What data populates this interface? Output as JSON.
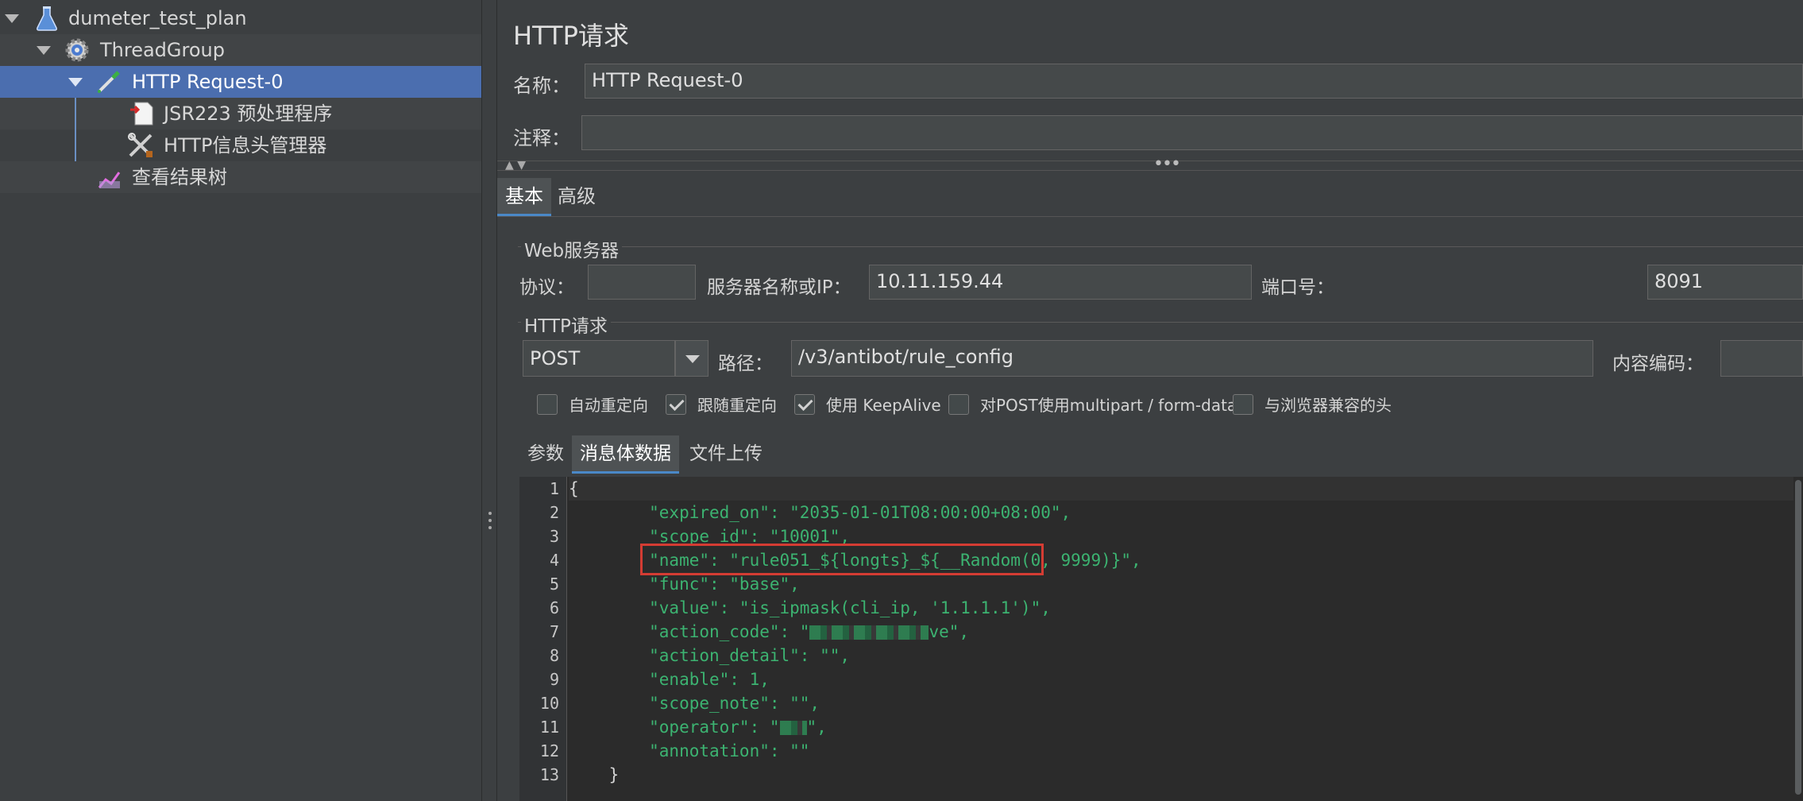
{
  "tree": {
    "items": [
      {
        "label": "dumeter_test_plan",
        "icon": "flask-icon"
      },
      {
        "label": "ThreadGroup",
        "icon": "gear-icon"
      },
      {
        "label": "HTTP Request-0",
        "icon": "pipette-icon"
      },
      {
        "label": "JSR223 预处理程序",
        "icon": "script-icon"
      },
      {
        "label": "HTTP信息头管理器",
        "icon": "tools-icon"
      },
      {
        "label": "查看结果树",
        "icon": "chart-icon"
      }
    ]
  },
  "panel": {
    "title": "HTTP请求",
    "name_label": "名称：",
    "name_value": "HTTP Request-0",
    "comment_label": "注释：",
    "comment_value": "",
    "tabs": [
      "基本",
      "高级"
    ],
    "web_server": {
      "section": "Web服务器",
      "protocol_label": "协议：",
      "protocol_value": "",
      "server_label": "服务器名称或IP：",
      "server_value": "10.11.159.44",
      "port_label": "端口号：",
      "port_value": "8091"
    },
    "http_request": {
      "section": "HTTP请求",
      "method": "POST",
      "path_label": "路径：",
      "path_value": "/v3/antibot/rule_config",
      "encoding_label": "内容编码：",
      "encoding_value": ""
    },
    "checkboxes": [
      {
        "label": "自动重定向",
        "checked": false
      },
      {
        "label": "跟随重定向",
        "checked": true
      },
      {
        "label": "使用 KeepAlive",
        "checked": true
      },
      {
        "label": "对POST使用multipart / form-data",
        "checked": false
      },
      {
        "label": "与浏览器兼容的头",
        "checked": false
      }
    ],
    "sub_tabs": [
      "参数",
      "消息体数据",
      "文件上传"
    ],
    "body_lines": [
      "{",
      "        \"expired_on\": \"2035-01-01T08:00:00+08:00\",",
      "        \"scope_id\": \"10001\",",
      "        \"name\": \"rule051_${longts}_${__Random(0, 9999)}\",",
      "        \"func\": \"base\",",
      "        \"value\": \"is_ipmask(cli_ip, '1.1.1.1')\",",
      "        \"action_code\": \"",
      "        \"action_detail\": \"\",",
      "        \"enable\": 1,",
      "        \"scope_note\": \"\",",
      "        \"operator\": \"",
      "        \"annotation\": \"\"",
      "    }"
    ],
    "line_numbers": [
      "1",
      "2",
      "3",
      "4",
      "5",
      "6",
      "7",
      "8",
      "9",
      "10",
      "11",
      "12",
      "13"
    ]
  }
}
